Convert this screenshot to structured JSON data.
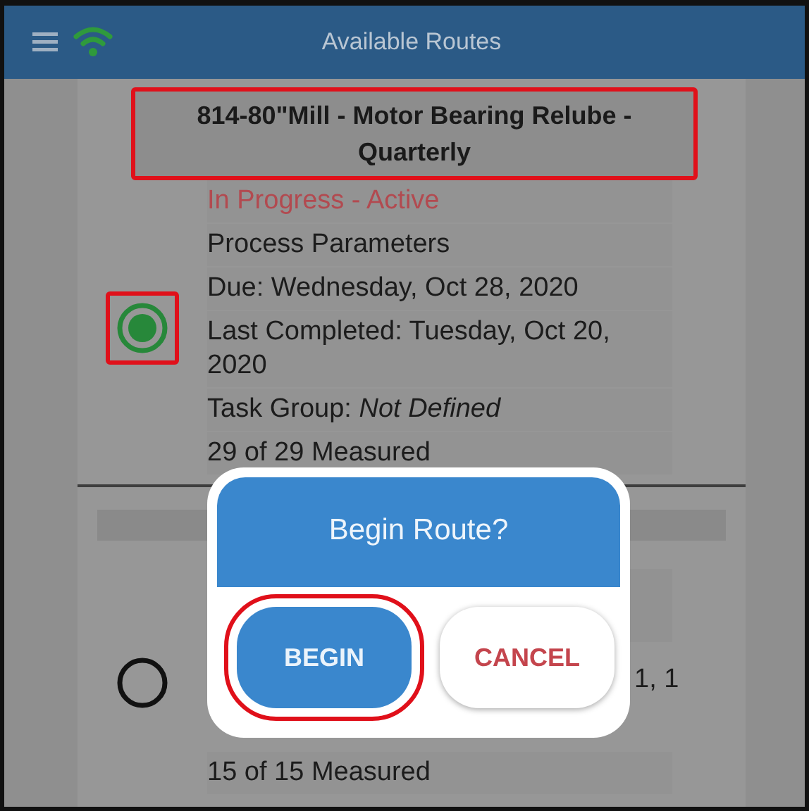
{
  "header": {
    "title": "Available Routes"
  },
  "routes": [
    {
      "title": "814-80\"Mill - Motor Bearing Relube - Quarterly",
      "highlighted": true,
      "selected": true,
      "status": "In Progress - Active",
      "lines": [
        {
          "kind": "plain",
          "text": "Process Parameters"
        },
        {
          "kind": "plain",
          "text": "Due: Wednesday, Oct 28, 2020"
        },
        {
          "kind": "plain",
          "text": "Last Completed: Tuesday, Oct 20, 2020"
        },
        {
          "kind": "rich",
          "text": "Task Group: *Not Defined*"
        },
        {
          "kind": "plain",
          "text": "29 of 29 Measured"
        }
      ]
    },
    {
      "selected": false,
      "lines": [
        {
          "kind": "tail",
          "text": "1, 1"
        },
        {
          "kind": "plain",
          "text": "15 of 15 Measured"
        }
      ]
    }
  ],
  "dialog": {
    "title": "Begin Route?",
    "buttons": [
      {
        "kind": "primary",
        "label": "BEGIN",
        "highlighted": true
      },
      {
        "kind": "secondary",
        "label": "CANCEL",
        "highlighted": false
      }
    ]
  }
}
